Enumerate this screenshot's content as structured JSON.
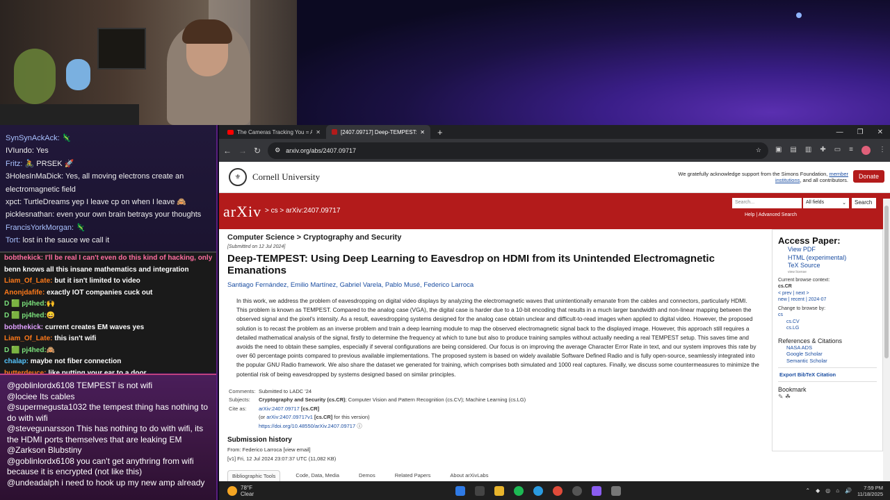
{
  "chat_top": [
    {
      "user": "SynSynAckAck:",
      "msg": "🦎"
    },
    {
      "user": "IVIundo:",
      "msg": "Yes"
    },
    {
      "user": "Fritz:",
      "msg": "🚴 PRSEK 🚀"
    },
    {
      "user": "3HolesInMaDick:",
      "msg": "Yes, all moving electrons create an electromagnetic field"
    },
    {
      "user": "xpct:",
      "msg": "TurtleDreams yep I leave cp on when I leave 🙈"
    },
    {
      "user": "picklesnathan:",
      "msg": "even your own brain betrays your thoughts"
    },
    {
      "user": "FrancisYorkMorgan:",
      "msg": "🦎"
    },
    {
      "user": "Tort:",
      "msg": "lost in the sauce we call it"
    }
  ],
  "chat_mid": [
    {
      "user": "",
      "msg": "bobthekick: I'll be real I can't even do this kind of hacking, only"
    },
    {
      "user": "",
      "msg": "benn knows all this insane mathematics and integration"
    },
    {
      "user": "Liam_Of_Late:",
      "msg": "but it isn't limited to video"
    },
    {
      "user": "Anonjdafife:",
      "msg": "exactly IOT companies cuck out"
    },
    {
      "user": "D 🟩 pj4hed:",
      "msg": "🙌"
    },
    {
      "user": "D 🟩 pj4hed:",
      "msg": "😄"
    },
    {
      "user": "bobthekick:",
      "msg": "current creates EM waves yes"
    },
    {
      "user": "Liam_Of_Late:",
      "msg": "this isn't wifi"
    },
    {
      "user": "D 🟩 pj4hed:",
      "msg": "🙈"
    },
    {
      "user": "chalap:",
      "msg": "maybe not fiber connection"
    },
    {
      "user": "butterdeuce:",
      "msg": "like putting your ear to a door"
    }
  ],
  "chat_bottom": [
    "@goblinlordx6108 TEMPEST is not wifi",
    "@lociee Its cables",
    "@supermegusta1032 the tempest thing has nothing to do with wifi",
    "@stevegunarsson This has nothing to do with wifi, its the HDMI ports themselves that are leaking EM",
    "@Zarkson Blubstiny",
    "@goblinlordx6108 you can't get anythring from wifi because it is encrypted (not like this)",
    "@undeadalph i need to hook up my new amp already"
  ],
  "browser": {
    "tabs": [
      "The Cameras Tracking You = A",
      "[2407.09717] Deep-TEMPEST: U"
    ],
    "url": "arxiv.org/abs/2407.09717"
  },
  "arxiv": {
    "institution": "Cornell University",
    "thanks": "We gratefully acknowledge support from the Simons Foundation,",
    "thanks_link": "member institutions",
    "thanks_tail": ", and all contributors.",
    "donate": "Donate",
    "logo": "arXiv",
    "crumb": "> cs > arXiv:2407.09717",
    "search_placeholder": "Search...",
    "search_field": "All fields",
    "search_button": "Search",
    "help": "Help | Advanced Search",
    "subject": "Computer Science > Cryptography and Security",
    "submitted": "[Submitted on 12 Jul 2024]",
    "title": "Deep-TEMPEST: Using Deep Learning to Eavesdrop on HDMI from its Unintended Electromagnetic Emanations",
    "authors": "Santiago Fernández, Emilio Martínez, Gabriel Varela, Pablo Musé, Federico Larroca",
    "abstract": "In this work, we address the problem of eavesdropping on digital video displays by analyzing the electromagnetic waves that unintentionally emanate from the cables and connectors, particularly HDMI. This problem is known as TEMPEST. Compared to the analog case (VGA), the digital case is harder due to a 10-bit encoding that results in a much larger bandwidth and non-linear mapping between the observed signal and the pixel's intensity. As a result, eavesdropping systems designed for the analog case obtain unclear and difficult-to-read images when applied to digital video. However, the proposed solution is to recast the problem as an inverse problem and train a deep learning module to map the observed electromagnetic signal back to the displayed image. However, this approach still requires a detailed mathematical analysis of the signal, firstly to determine the frequency at which to tune but also to produce training samples without actually needing a real TEMPEST setup. This saves time and avoids the need to obtain these samples, especially if several configurations are being considered. Our focus is on improving the average Character Error Rate in text, and our system improves this rate by over 60 percentage points compared to previous available implementations. The proposed system is based on widely available Software Defined Radio and is fully open-source, seamlessly integrated into the popular GNU Radio framework. We also share the dataset we generated for training, which comprises both simulated and 1000 real captures. Finally, we discuss some countermeasures to minimize the potential risk of being eavesdropped by systems designed based on similar principles.",
    "comments_k": "Comments:",
    "comments_v": "Submitted to LADC '24",
    "subjects_k": "Subjects:",
    "subjects_bold": "Cryptography and Security (cs.CR)",
    "subjects_rest": "; Computer Vision and Pattern Recognition (cs.CV); Machine Learning (cs.LG)",
    "citeas_k": "Cite as:",
    "citeas_link": "arXiv:2407.09717",
    "citeas_cat": "[cs.CR]",
    "citeas_v1_pre": "(or ",
    "citeas_v1_link": "arXiv:2407.09717v1",
    "citeas_v1_cat": " [cs.CR]",
    "citeas_v1_post": " for this version)",
    "doi": "https://doi.org/10.48550/arXiv.2407.09717",
    "history_h": "Submission history",
    "history_from": "From: Federico Larroca [view email]",
    "history_v1": "[v1] Fri, 12 Jul 2024 23:07:37 UTC (11,082 KB)",
    "bottom_tabs": [
      "Bibliographic Tools",
      "Code, Data, Media",
      "Demos",
      "Related Papers",
      "About arXivLabs"
    ],
    "access_h": "Access Paper:",
    "access_links": [
      "View PDF",
      "HTML (experimental)",
      "TeX Source"
    ],
    "view_license": "view license",
    "context_label": "Current browse context:",
    "context_value": "cs.CR",
    "context_nav": "< prev   |   next >",
    "context_dates": "new | recent | 2024-07",
    "change_label": "Change to browse by:",
    "change_links": [
      "cs",
      "cs.CV",
      "cs.LG"
    ],
    "refs_h": "References & Citations",
    "refs_links": [
      "NASA ADS",
      "Google Scholar",
      "Semantic Scholar"
    ],
    "bibtex": "Export BibTeX Citation",
    "bookmark": "Bookmark"
  },
  "taskbar": {
    "temp": "78°F",
    "condition": "Clear",
    "time": "7:59 PM",
    "date": "11/18/2025"
  },
  "colors": {
    "arxiv_red": "#b31b1b",
    "link_blue": "#1a4da1"
  }
}
